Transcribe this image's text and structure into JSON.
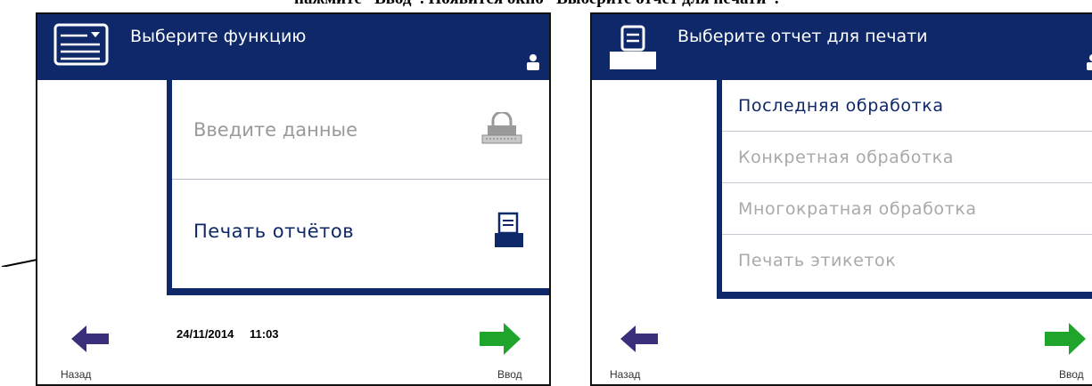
{
  "caption": "нажмите “Ввод”. Появится окно “Выберите отчет для печати”.",
  "colors": {
    "header": "#0e2869",
    "accent_green": "#1fa52c",
    "back_arrow": "#3a2f7a"
  },
  "left_screen": {
    "header": {
      "title": "Выберите функцию",
      "icon": "menu-card-icon"
    },
    "menu": [
      {
        "label": "Введите данные",
        "icon": "lock-keyboard-icon",
        "enabled": false
      },
      {
        "label": "Печать отчётов",
        "icon": "printer-icon",
        "enabled": true
      }
    ],
    "footer": {
      "date": "24/11/2014",
      "time": "11:03",
      "back_label": "Назад",
      "enter_label": "Ввод"
    }
  },
  "right_screen": {
    "header": {
      "title": "Выберите отчет для печати",
      "icon": "printer-icon"
    },
    "reports": [
      {
        "label": "Последняя обработка",
        "active": true
      },
      {
        "label": "Конкретная обработка",
        "active": false
      },
      {
        "label": "Многократная обработка",
        "active": false
      },
      {
        "label": "Печать этикеток",
        "active": false
      }
    ],
    "footer": {
      "back_label": "Назад",
      "enter_label": "Ввод"
    }
  }
}
